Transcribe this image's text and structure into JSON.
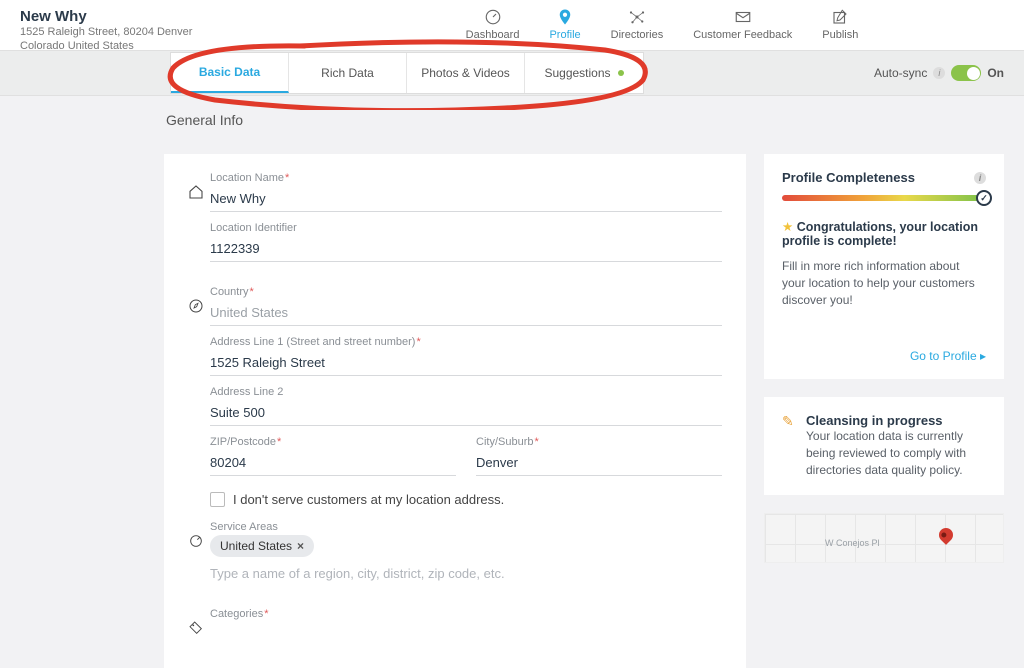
{
  "header": {
    "title": "New Why",
    "address_line": "1525 Raleigh Street, 80204 Denver",
    "address_region": "Colorado United States"
  },
  "nav": [
    {
      "label": "Dashboard"
    },
    {
      "label": "Profile"
    },
    {
      "label": "Directories"
    },
    {
      "label": "Customer Feedback"
    },
    {
      "label": "Publish"
    }
  ],
  "tabs": [
    {
      "label": "Basic Data"
    },
    {
      "label": "Rich Data"
    },
    {
      "label": "Photos & Videos"
    },
    {
      "label": "Suggestions"
    }
  ],
  "autosync": {
    "label": "Auto-sync",
    "state": "On"
  },
  "section_title": "General Info",
  "form": {
    "location_name_label": "Location Name",
    "location_name": "New Why",
    "location_id_label": "Location Identifier",
    "location_id": "1122339",
    "country_label": "Country",
    "country": "United States",
    "addr1_label": "Address Line 1 (Street and street number)",
    "addr1": "1525 Raleigh Street",
    "addr2_label": "Address Line 2",
    "addr2": "Suite 500",
    "zip_label": "ZIP/Postcode",
    "zip": "80204",
    "city_label": "City/Suburb",
    "city": "Denver",
    "hide_addr": "I don't serve customers at my location address.",
    "service_areas_label": "Service Areas",
    "service_chip": "United States",
    "service_placeholder": "Type a name of a region, city, district, zip code, etc.",
    "categories_label": "Categories"
  },
  "completeness": {
    "title": "Profile Completeness",
    "congrats": "Congratulations, your location profile is complete!",
    "desc": "Fill in more rich information about your location to help your customers discover you!",
    "link": "Go to Profile ▸"
  },
  "cleansing": {
    "title": "Cleansing in progress",
    "desc": "Your location data is currently being reviewed to comply with directories data quality policy."
  },
  "map": {
    "street": "W Conejos Pl"
  }
}
